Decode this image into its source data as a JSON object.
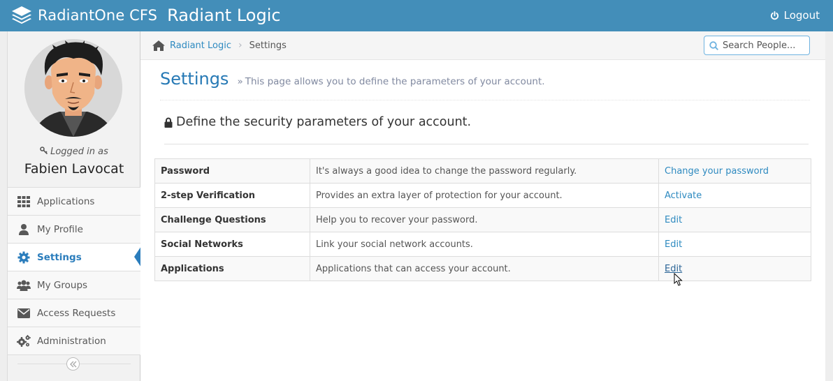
{
  "app": {
    "product_name": "RadiantOne CFS",
    "company_name": "Radiant Logic",
    "logout_label": "Logout",
    "accent_color": "#438eb9"
  },
  "user": {
    "logged_in_label": "Logged in as",
    "name": "Fabien Lavocat"
  },
  "sidebar": {
    "items": [
      {
        "label": "Applications",
        "icon": "grid-icon",
        "active": false
      },
      {
        "label": "My Profile",
        "icon": "user-icon",
        "active": false
      },
      {
        "label": "Settings",
        "icon": "gear-icon",
        "active": true
      },
      {
        "label": "My Groups",
        "icon": "users-icon",
        "active": false
      },
      {
        "label": "Access Requests",
        "icon": "envelope-icon",
        "active": false
      },
      {
        "label": "Administration",
        "icon": "cogs-icon",
        "active": false
      }
    ],
    "collapse_icon": "double-chevron-left-icon"
  },
  "breadcrumb": {
    "home_label": "Radiant Logic",
    "current_label": "Settings"
  },
  "search": {
    "placeholder": "Search People..."
  },
  "page": {
    "title": "Settings",
    "subtitle": "This page allows you to define the parameters of your account.",
    "section_title": "Define the security parameters of your account."
  },
  "settings": [
    {
      "name": "Password",
      "description": "It's always a good idea to change the password regularly.",
      "action": "Change your password"
    },
    {
      "name": "2-step Verification",
      "description": "Provides an extra layer of protection for your account.",
      "action": "Activate"
    },
    {
      "name": "Challenge Questions",
      "description": "Help you to recover your password.",
      "action": "Edit"
    },
    {
      "name": "Social Networks",
      "description": "Link your social network accounts.",
      "action": "Edit"
    },
    {
      "name": "Applications",
      "description": "Applications that can access your account.",
      "action": "Edit"
    }
  ]
}
